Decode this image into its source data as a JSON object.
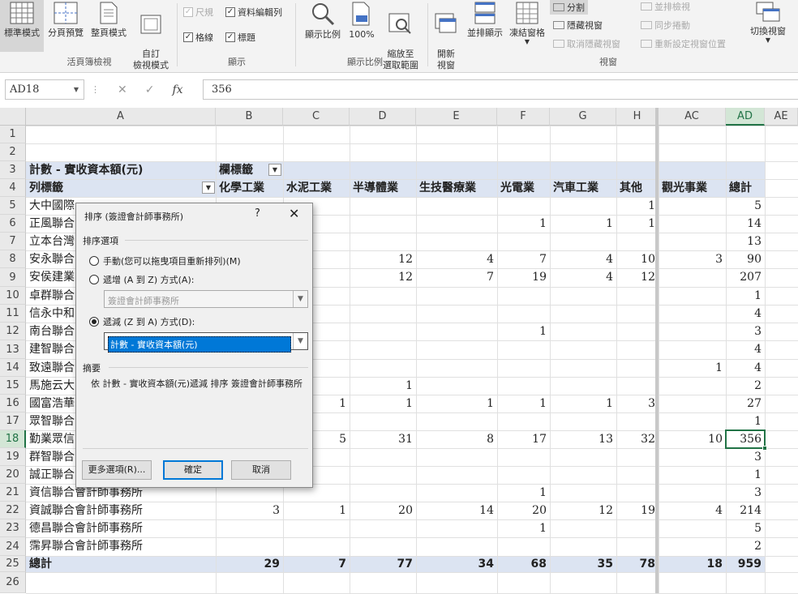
{
  "ribbon": {
    "workbook_views": {
      "normal": "標準模式",
      "page_break": "分頁預覽",
      "page_layout": "整頁模式",
      "custom_views": "自訂\n檢視模式",
      "group": "活頁簿檢視"
    },
    "show": {
      "ruler": "尺規",
      "formula_bar": "資料編輯列",
      "gridlines": "格線",
      "headings": "標題",
      "group": "顯示"
    },
    "zoom": {
      "zoom": "顯示比例",
      "hundred": "100%",
      "zoom_selection": "縮放至\n選取範圍",
      "group": "顯示比例"
    },
    "window": {
      "new_window": "開新\n視窗",
      "arrange_all": "並排顯示",
      "freeze_panes": "凍結窗格",
      "split": "分割",
      "hide": "隱藏視窗",
      "unhide": "取消隱藏視窗",
      "side_by_side": "並排檢視",
      "sync_scroll": "同步捲動",
      "reset_position": "重新設定視窗位置",
      "switch_windows": "切換視窗",
      "group": "視窗"
    }
  },
  "formula_bar": {
    "name_box": "AD18",
    "formula": "356"
  },
  "columns": [
    "A",
    "B",
    "C",
    "D",
    "E",
    "F",
    "G",
    "H",
    "AC",
    "AD",
    "AE"
  ],
  "rows": [
    "1",
    "2",
    "3",
    "4",
    "5",
    "6",
    "7",
    "8",
    "9",
    "10",
    "11",
    "12",
    "13",
    "14",
    "15",
    "16",
    "17",
    "18",
    "19",
    "20",
    "21",
    "22",
    "23",
    "24",
    "25",
    "26"
  ],
  "pivot": {
    "value_label": "計數 - 實收資本額(元)",
    "col_label": "欄標籤",
    "row_label": "列標籤",
    "headers": [
      "化學工業",
      "水泥工業",
      "半導體業",
      "生技醫療業",
      "光電業",
      "汽車工業",
      "其他",
      "觀光事業",
      "總計"
    ],
    "rows": [
      {
        "name": "大中國際",
        "vals": [
          "",
          "",
          "",
          "",
          "",
          "",
          "1",
          "",
          "5"
        ]
      },
      {
        "name": "正風聯合",
        "vals": [
          "",
          "",
          "",
          "",
          "1",
          "1",
          "1",
          "",
          "14"
        ]
      },
      {
        "name": "立本台灣",
        "vals": [
          "",
          "",
          "",
          "",
          "",
          "",
          "",
          "",
          "13"
        ]
      },
      {
        "name": "安永聯合",
        "vals": [
          "",
          "",
          "12",
          "4",
          "7",
          "4",
          "10",
          "3",
          "90"
        ]
      },
      {
        "name": "安侯建業",
        "vals": [
          "",
          "",
          "12",
          "7",
          "19",
          "4",
          "12",
          "",
          "207"
        ]
      },
      {
        "name": "卓群聯合",
        "vals": [
          "",
          "",
          "",
          "",
          "",
          "",
          "",
          "",
          "1"
        ]
      },
      {
        "name": "信永中和",
        "vals": [
          "",
          "",
          "",
          "",
          "",
          "",
          "",
          "",
          "4"
        ]
      },
      {
        "name": "南台聯合",
        "vals": [
          "",
          "",
          "",
          "",
          "1",
          "",
          "",
          "",
          "3"
        ]
      },
      {
        "name": "建智聯合",
        "vals": [
          "",
          "",
          "",
          "",
          "",
          "",
          "",
          "",
          "4"
        ]
      },
      {
        "name": "致遠聯合",
        "vals": [
          "",
          "",
          "",
          "",
          "",
          "",
          "",
          "1",
          "4"
        ]
      },
      {
        "name": "馬施云大",
        "vals": [
          "",
          "",
          "1",
          "",
          "",
          "",
          "",
          "",
          "2"
        ]
      },
      {
        "name": "國富浩華",
        "vals": [
          "",
          "1",
          "1",
          "1",
          "1",
          "1",
          "3",
          "",
          "27"
        ]
      },
      {
        "name": "眾智聯合",
        "vals": [
          "",
          "",
          "",
          "",
          "",
          "",
          "",
          "",
          "1"
        ]
      },
      {
        "name": "勤業眾信",
        "vals": [
          "",
          "5",
          "31",
          "8",
          "17",
          "13",
          "32",
          "10",
          "356"
        ]
      },
      {
        "name": "群智聯合",
        "vals": [
          "",
          "",
          "",
          "",
          "",
          "",
          "",
          "",
          "3"
        ]
      },
      {
        "name": "誠正聯合",
        "vals": [
          "",
          "",
          "",
          "",
          "",
          "",
          "",
          "",
          "1"
        ]
      },
      {
        "name": "資信聯合會計師事務所",
        "vals": [
          "",
          "",
          "",
          "",
          "1",
          "",
          "",
          "",
          "3"
        ]
      },
      {
        "name": "資誠聯合會計師事務所",
        "vals": [
          "3",
          "1",
          "20",
          "14",
          "20",
          "12",
          "19",
          "4",
          "214"
        ]
      },
      {
        "name": "德昌聯合會計師事務所",
        "vals": [
          "",
          "",
          "",
          "",
          "1",
          "",
          "",
          "",
          "5"
        ]
      },
      {
        "name": "霈昇聯合會計師事務所",
        "vals": [
          "",
          "",
          "",
          "",
          "",
          "",
          "",
          "",
          "2"
        ]
      }
    ],
    "total_label": "總計",
    "totals": [
      "29",
      "7",
      "77",
      "34",
      "68",
      "35",
      "78",
      "18",
      "959"
    ]
  },
  "dialog": {
    "title": "排序 (簽證會計師事務所)",
    "help": "?",
    "close": "✕",
    "options_label": "排序選項",
    "manual": "手動(您可以拖曳項目重新排列)(M)",
    "ascending": "遞增 (A 到 Z) 方式(A):",
    "ascending_value": "簽證會計師事務所",
    "descending": "遞減 (Z 到 A) 方式(D):",
    "descending_value": "計數 - 實收資本額(元)",
    "summary_label": "摘要",
    "summary_text": "依 計數 - 實收資本額(元)遞減 排序 簽證會計師事務所",
    "more_options": "更多選項(R)...",
    "ok": "確定",
    "cancel": "取消"
  }
}
